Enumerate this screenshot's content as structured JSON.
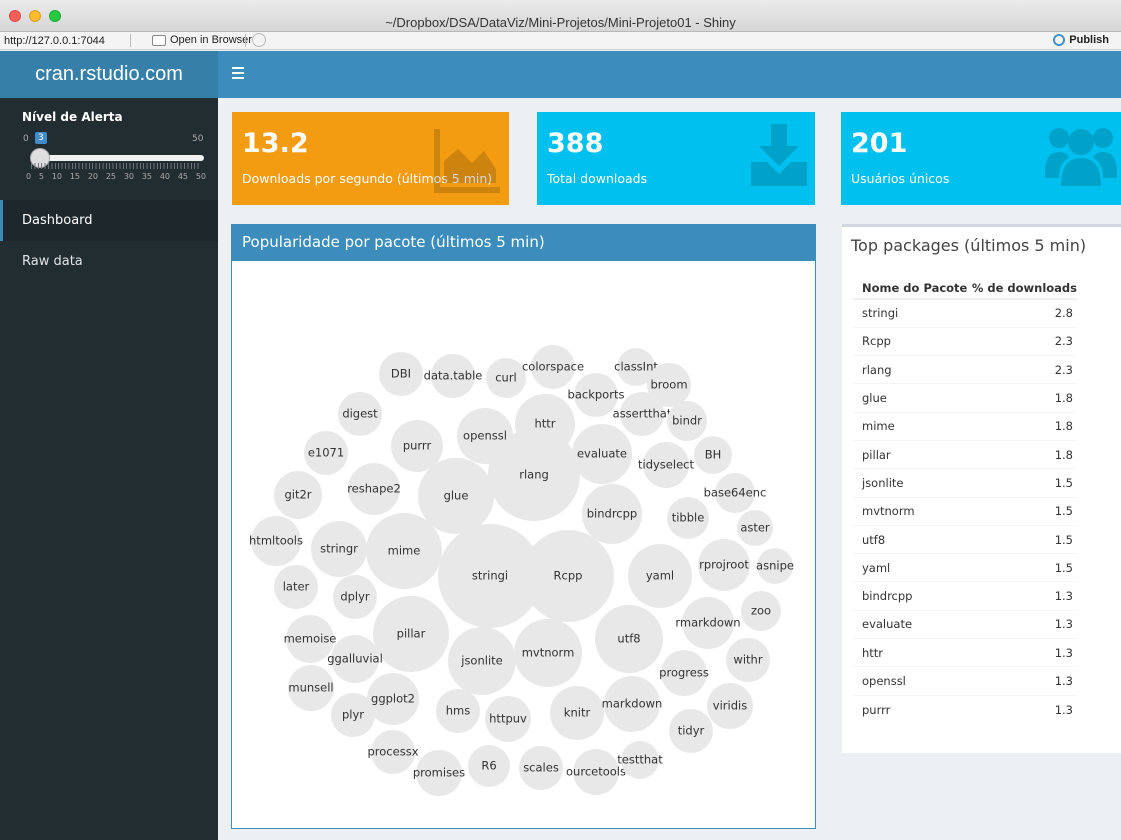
{
  "window": {
    "title": "~/Dropbox/DSA/DataViz/Mini-Projetos/Mini-Projeto01 - Shiny"
  },
  "toolbar": {
    "url": "http://127.0.0.1:7044",
    "open_browser_label": "Open in Browser",
    "publish_label": "Publish"
  },
  "header": {
    "logo_text": "cran.rstudio.com"
  },
  "sidebar": {
    "slider": {
      "label": "Nível de Alerta",
      "min": "0",
      "max": "50",
      "value": "3",
      "tick_labels": [
        "0",
        "5",
        "10",
        "15",
        "20",
        "25",
        "30",
        "35",
        "40",
        "45",
        "50"
      ]
    },
    "items": [
      {
        "label": "Dashboard",
        "active": true
      },
      {
        "label": "Raw data",
        "active": false
      }
    ]
  },
  "value_boxes": [
    {
      "value": "13.2",
      "label": "Downloads por segundo (últimos 5 min)",
      "color": "#f39c12",
      "icon": "area-chart-icon"
    },
    {
      "value": "388",
      "label": "Total downloads",
      "color": "#00c0ef",
      "icon": "download-icon"
    },
    {
      "value": "201",
      "label": "Usuários únicos",
      "color": "#00c0ef",
      "icon": "users-icon"
    }
  ],
  "bubble_box": {
    "title": "Popularidade por pacote (últimos 5 min)",
    "packages": [
      "stringi",
      "Rcpp",
      "rlang",
      "glue",
      "mime",
      "pillar",
      "jsonlite",
      "mvtnorm",
      "utf8",
      "yaml",
      "bindrcpp",
      "evaluate",
      "httr",
      "openssl",
      "purrr",
      "DBI",
      "data.table",
      "curl",
      "colorspace",
      "classInt",
      "broom",
      "backports",
      "assertthat",
      "bindr",
      "digest",
      "e1071",
      "reshape2",
      "git2r",
      "tidyselect",
      "BH",
      "base64enc",
      "tibble",
      "aster",
      "htmltools",
      "stringr",
      "rprojroot",
      "asnipe",
      "later",
      "dplyr",
      "zoo",
      "rmarkdown",
      "memoise",
      "ggalluvial",
      "withr",
      "progress",
      "munsell",
      "ggplot2",
      "plyr",
      "hms",
      "httpuv",
      "knitr",
      "markdown",
      "viridis",
      "tidyr",
      "processx",
      "promises",
      "R6",
      "scales",
      "ourcetools",
      "testthat"
    ]
  },
  "top_packages": {
    "title": "Top packages (últimos 5 min)",
    "columns": [
      "Nome do Pacote",
      "% de downloads"
    ],
    "rows": [
      [
        "stringi",
        "2.8"
      ],
      [
        "Rcpp",
        "2.3"
      ],
      [
        "rlang",
        "2.3"
      ],
      [
        "glue",
        "1.8"
      ],
      [
        "mime",
        "1.8"
      ],
      [
        "pillar",
        "1.8"
      ],
      [
        "jsonlite",
        "1.5"
      ],
      [
        "mvtnorm",
        "1.5"
      ],
      [
        "utf8",
        "1.5"
      ],
      [
        "yaml",
        "1.5"
      ],
      [
        "bindrcpp",
        "1.3"
      ],
      [
        "evaluate",
        "1.3"
      ],
      [
        "httr",
        "1.3"
      ],
      [
        "openssl",
        "1.3"
      ],
      [
        "purrr",
        "1.3"
      ]
    ]
  }
}
